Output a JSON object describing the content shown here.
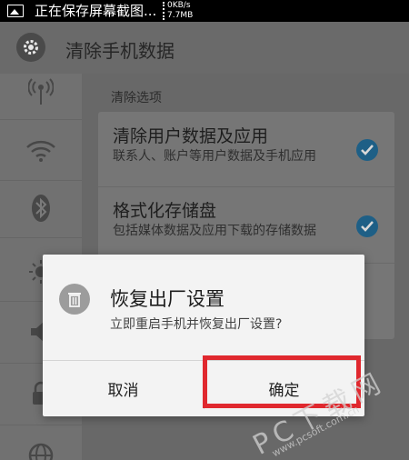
{
  "status_bar": {
    "title": "正在保存屏幕截图...",
    "speed_up": "0KB/s",
    "speed_down": "7.7MB"
  },
  "app_bar": {
    "title": "清除手机数据",
    "icon": "gear-icon"
  },
  "sidebar": {
    "icons": [
      "broadcast-icon",
      "wifi-icon",
      "bluetooth-icon",
      "brightness-icon",
      "volume-icon",
      "lock-icon",
      "globe-icon"
    ]
  },
  "content": {
    "section_label": "清除选项",
    "options": [
      {
        "title": "清除用户数据及应用",
        "description": "联系人、账户等用户数据及手机应用",
        "checked": true
      },
      {
        "title": "格式化存储盘",
        "description": "包括媒体数据及应用下载的存储数据",
        "checked": true
      }
    ]
  },
  "dialog": {
    "icon": "trash-icon",
    "title": "恢复出厂设置",
    "message": "立即重启手机并恢复出厂设置?",
    "cancel_label": "取消",
    "confirm_label": "确定"
  },
  "watermark": {
    "brand": "PC下载网",
    "url": "www.pcsoft.com.cn"
  },
  "colors": {
    "highlight": "#e0282e",
    "check": "#1e5f86"
  }
}
